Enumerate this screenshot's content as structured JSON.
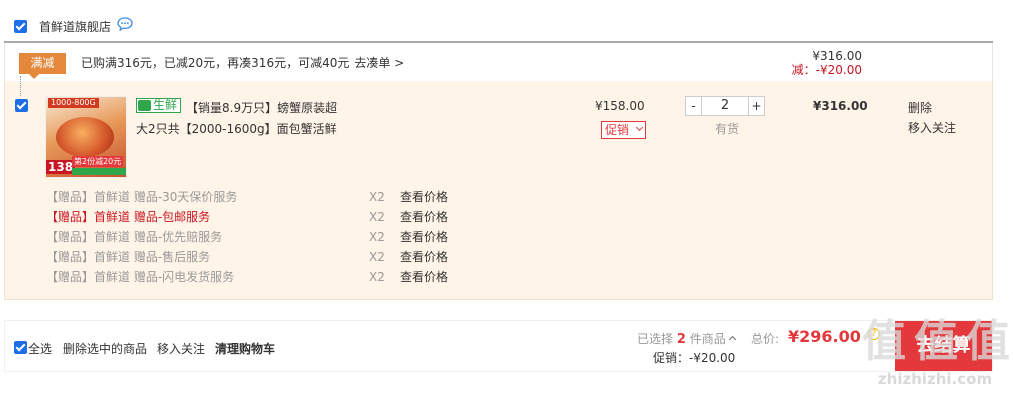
{
  "shop": {
    "name": "首鲜道旗舰店",
    "chat_icon": "chat-bubble-icon"
  },
  "promo": {
    "tag": "满减",
    "text": "已购满316元，已减20元，再凑316元，可减40元",
    "link": "去凑单 >",
    "sum": "¥316.00",
    "discount": "减：-¥20.00"
  },
  "item": {
    "badge": "生鲜",
    "title_line1": "【销量8.9万只】螃蟹原装超",
    "title_line2": "大2只共【2000-1600g】面包蟹活鲜",
    "thumb": {
      "top_text": "1000-800G",
      "price": "138",
      "promo": "第2份减20元"
    },
    "price": "¥158.00",
    "promo_select": "促销",
    "quantity": "2",
    "qty_minus": "-",
    "qty_plus": "+",
    "stock": "有货",
    "subtotal": "¥316.00",
    "delete": "删除",
    "move_to_follow": "移入关注"
  },
  "gifts": [
    {
      "name": "【赠品】首鲜道 赠品-30天保价服务",
      "qty": "X2",
      "link": "查看价格",
      "highlight": false
    },
    {
      "name": "【赠品】首鲜道 赠品-包邮服务",
      "qty": "X2",
      "link": "查看价格",
      "highlight": true
    },
    {
      "name": "【赠品】首鲜道 赠品-优先赔服务",
      "qty": "X2",
      "link": "查看价格",
      "highlight": false
    },
    {
      "name": "【赠品】首鲜道 赠品-售后服务",
      "qty": "X2",
      "link": "查看价格",
      "highlight": false
    },
    {
      "name": "【赠品】首鲜道 赠品-闪电发货服务",
      "qty": "X2",
      "link": "查看价格",
      "highlight": false
    }
  ],
  "bottom": {
    "select_all": "全选",
    "delete_selected": "删除选中的商品",
    "move_to_follow": "移入关注",
    "clear_cart": "清理购物车",
    "selected_prefix": "已选择",
    "selected_count": "2",
    "selected_suffix": "件商品",
    "total_label": "总价:",
    "total_value": "¥296.00",
    "promo_label": "促销：-¥20.00",
    "checkout": "去结算"
  },
  "watermark": {
    "chars": [
      "值",
      "值",
      "值"
    ],
    "url": "zhizhizhi.com"
  },
  "colors": {
    "accent_red": "#e4393c",
    "checkbox_blue": "#1e6fe6",
    "promo_orange": "#e4883b",
    "fresh_green": "#2fa64b",
    "item_bg": "#fff4e8"
  }
}
